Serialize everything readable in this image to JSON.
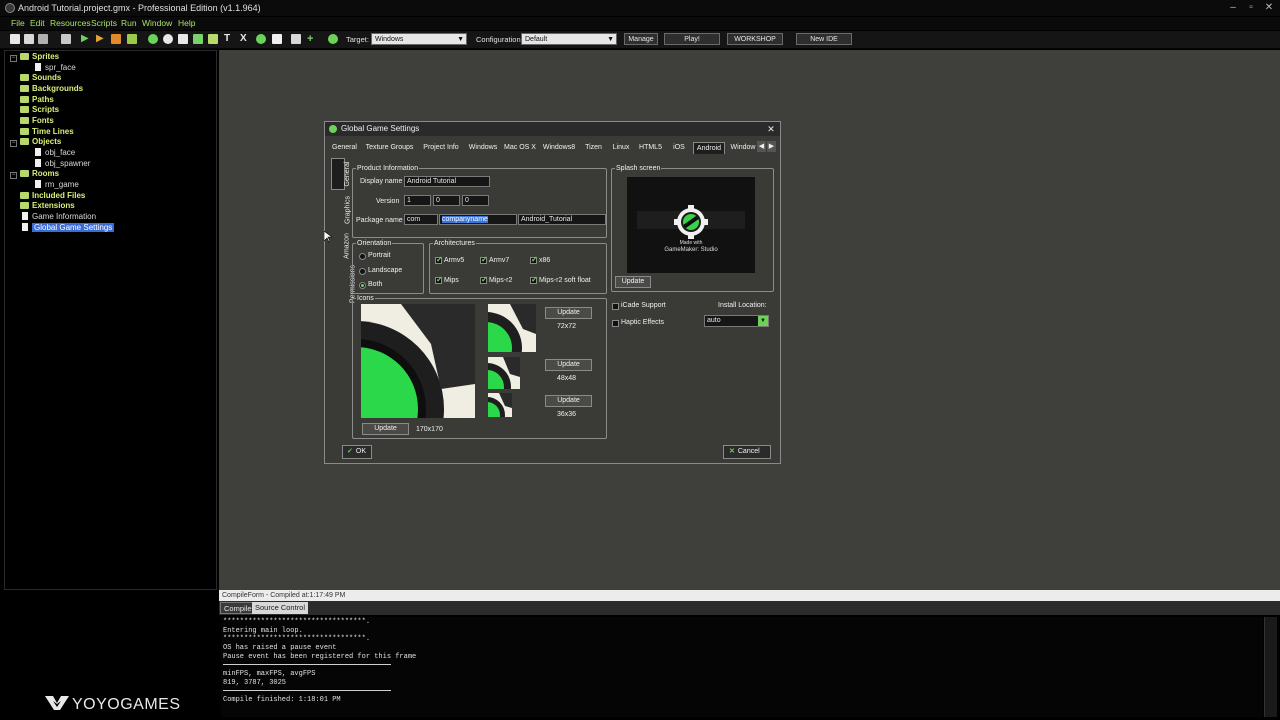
{
  "window": {
    "title": "Android Tutorial.project.gmx  -  Professional Edition (v1.1.964)"
  },
  "menu": [
    "File",
    "Edit",
    "Resources",
    "Scripts",
    "Run",
    "Window",
    "Help"
  ],
  "toolbar": {
    "target_label": "Target:",
    "target_value": "Windows",
    "config_label": "Configuration:",
    "config_value": "Default",
    "manage": "Manage",
    "play": "Play!",
    "workshop": "WORKSHOP",
    "newide": "New IDE"
  },
  "tree": {
    "sprites": "Sprites",
    "spr_face": "spr_face",
    "sounds": "Sounds",
    "backgrounds": "Backgrounds",
    "paths": "Paths",
    "scripts": "Scripts",
    "fonts": "Fonts",
    "timelines": "Time Lines",
    "objects": "Objects",
    "obj_face": "obj_face",
    "obj_spawner": "obj_spawner",
    "rooms": "Rooms",
    "rm_game": "rm_game",
    "included": "Included Files",
    "extensions": "Extensions",
    "gameinfo": "Game Information",
    "ggs": "Global Game Settings"
  },
  "brand": {
    "text": "YOYOGAMES"
  },
  "compile": {
    "header": "CompileForm - Compiled at:1:17:49 PM",
    "tabs": [
      "Compile",
      "Source Control"
    ],
    "lines": {
      "l1": "**********************************.",
      "l2": "Entering main loop.",
      "l3": "**********************************.",
      "l4": "OS has raised a pause event",
      "l5": "Pause event has been registered for this frame",
      "l6": "minFPS, maxFPS, avgFPS",
      "l7": "819, 3787, 3025",
      "l8": "Compile finished: 1:18:01 PM"
    }
  },
  "dialog": {
    "title": "Global Game Settings",
    "tabs": [
      "General",
      "Texture Groups",
      "Project Info",
      "Windows",
      "Mac OS X",
      "Windows8",
      "Tizen",
      "Linux",
      "HTML5",
      "iOS",
      "Android",
      "Window"
    ],
    "side_tabs": [
      "General",
      "Graphics",
      "Amazon",
      "Permissions"
    ],
    "product": {
      "legend": "Product Information",
      "display_name_label": "Display name",
      "display_name": "Android Tutorial",
      "version_label": "Version",
      "v1": "1",
      "v2": "0",
      "v3": "0",
      "package_label": "Package name",
      "pkg1": "com",
      "pkg2": "companyname",
      "pkg3": "Android_Tutorial"
    },
    "splash": {
      "legend": "Splash screen",
      "made_with": "Made with",
      "gms": "GameMaker: Studio",
      "update": "Update"
    },
    "orientation": {
      "legend": "Orientation",
      "portrait": "Portrait",
      "landscape": "Landscape",
      "both": "Both",
      "selected": "Both"
    },
    "arch": {
      "legend": "Architectures",
      "armv5": "Armv5",
      "armv7": "Armv7",
      "x86": "x86",
      "mips": "Mips",
      "mipsr2": "Mips-r2",
      "mipsr2sf": "Mips-r2 soft float"
    },
    "icons": {
      "legend": "Icons",
      "update": "Update",
      "size_72": "72x72",
      "size_48": "48x48",
      "size_36": "36x36",
      "size_170": "170x170"
    },
    "options": {
      "icade": "iCade Support",
      "haptic": "Haptic Effects",
      "install_label": "Install Location:",
      "install_value": "auto"
    },
    "ok": "OK",
    "cancel": "Cancel"
  }
}
